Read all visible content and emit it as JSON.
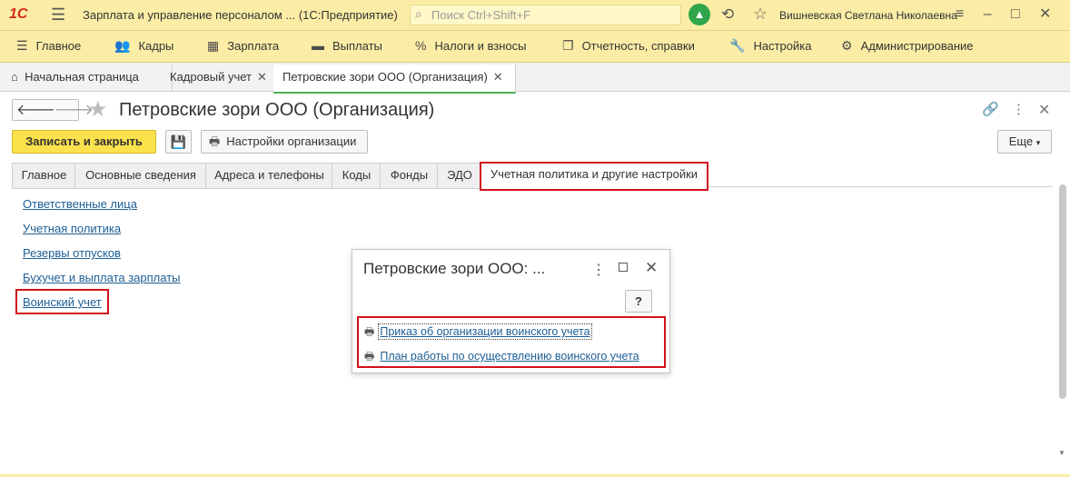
{
  "titlebar": {
    "logo": "1С",
    "app_title": "Зарплата и управление персоналом ...  (1С:Предприятие)",
    "search_placeholder": "Поиск Ctrl+Shift+F",
    "user": "Вишневская Светлана Николаевна"
  },
  "menu": [
    {
      "label": "Главное",
      "icon": "hamburger-icon"
    },
    {
      "label": "Кадры",
      "icon": "people-icon"
    },
    {
      "label": "Зарплата",
      "icon": "calculator-icon"
    },
    {
      "label": "Выплаты",
      "icon": "wallet-icon"
    },
    {
      "label": "Налоги и взносы",
      "icon": "percent-icon"
    },
    {
      "label": "Отчетность, справки",
      "icon": "reports-icon"
    },
    {
      "label": "Настройка",
      "icon": "wrench-icon"
    },
    {
      "label": "Администрирование",
      "icon": "gear-icon"
    }
  ],
  "window_tabs": [
    {
      "label": "Начальная страница"
    },
    {
      "label": "Кадровый учет"
    },
    {
      "label": "Петровские зори ООО (Организация)"
    }
  ],
  "form": {
    "title": "Петровские зори ООО (Организация)",
    "save_close": "Записать и закрыть",
    "settings_button": "Настройки организации",
    "more_button": "Еще"
  },
  "form_tabs": [
    "Главное",
    "Основные сведения",
    "Адреса и телефоны",
    "Коды",
    "Фонды",
    "ЭДО",
    "Учетная политика и другие настройки"
  ],
  "links": [
    "Ответственные лица",
    "Учетная политика",
    "Резервы отпусков",
    "Бухучет и выплата зарплаты",
    "Воинский учет"
  ],
  "popup": {
    "title": "Петровские зори ООО: ...",
    "help": "?",
    "links": [
      "Приказ об организации воинского учета",
      "План работы по осуществлению воинского учета"
    ]
  },
  "colors": {
    "accent_yellow": "#fbe14c",
    "highlight_red": "#d0121b",
    "link_blue": "#1d5e94",
    "panel_yellow": "#fbeda6"
  }
}
